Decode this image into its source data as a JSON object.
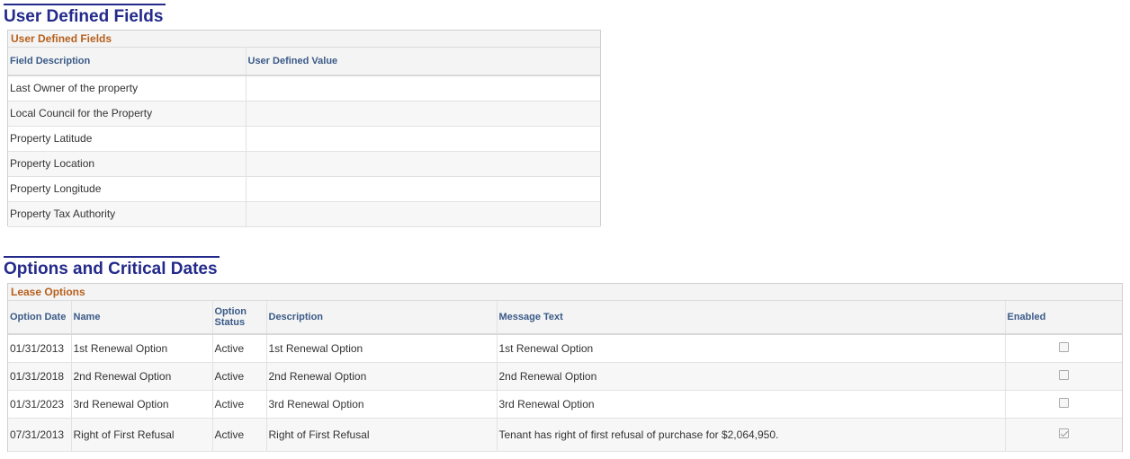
{
  "udf_section": {
    "title": "User Defined Fields",
    "grid_caption": "User Defined Fields",
    "columns": [
      "Field Description",
      "User Defined Value"
    ],
    "rows": [
      {
        "description": "Last Owner of the property",
        "value": ""
      },
      {
        "description": "Local Council for the Property",
        "value": ""
      },
      {
        "description": "Property Latitude",
        "value": ""
      },
      {
        "description": "Property Location",
        "value": ""
      },
      {
        "description": "Property Longitude",
        "value": ""
      },
      {
        "description": "Property Tax Authority",
        "value": ""
      }
    ]
  },
  "options_section": {
    "title": "Options and Critical Dates",
    "grid_caption": "Lease Options",
    "columns": [
      "Option Date",
      "Name",
      "Option Status",
      "Description",
      "Message Text",
      "Enabled"
    ],
    "rows": [
      {
        "date": "01/31/2013",
        "name": "1st Renewal Option",
        "status": "Active",
        "description": "1st Renewal Option",
        "message": "1st Renewal Option",
        "enabled": false
      },
      {
        "date": "01/31/2018",
        "name": "2nd Renewal Option",
        "status": "Active",
        "description": "2nd Renewal Option",
        "message": "2nd Renewal Option",
        "enabled": false
      },
      {
        "date": "01/31/2023",
        "name": "3rd Renewal Option",
        "status": "Active",
        "description": "3rd Renewal Option",
        "message": "3rd Renewal Option",
        "enabled": false
      },
      {
        "date": "07/31/2013",
        "name": "Right of First Refusal",
        "status": "Active",
        "description": "Right of First Refusal",
        "message": "Tenant has right of first refusal of purchase  for $2,064,950.",
        "enabled": true
      }
    ]
  },
  "colors": {
    "section_title": "#232a8a",
    "grid_caption": "#b75f1c",
    "column_header": "#3a5a88"
  }
}
